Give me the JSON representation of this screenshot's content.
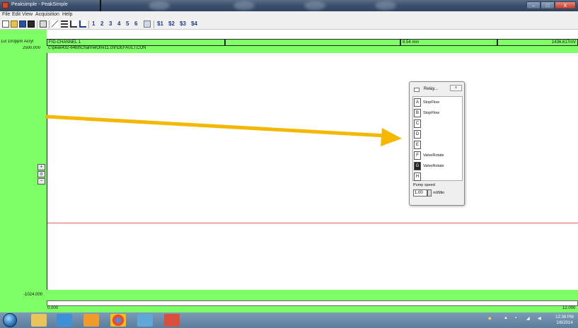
{
  "window": {
    "title": "Peaksimple - PeakSimple",
    "controls": {
      "minimize": "–",
      "maximize": "□",
      "close": "X"
    }
  },
  "menu": [
    "File",
    "Edit",
    "View",
    "Acquisition",
    "Help"
  ],
  "toolbar": {
    "channel_numbers": [
      "1",
      "2",
      "3",
      "4",
      "5",
      "6"
    ],
    "multi_buttons": [
      "$1",
      "$2",
      "$3",
      "$4"
    ]
  },
  "chromatogram": {
    "sample_label": "1ul 100ppm Acryl",
    "channel": "FID-CHANNEL 1",
    "time_readout": "8.54 min",
    "value_readout": "1436.617mV",
    "y_max": "2500.000",
    "file_path": "c:\\peak432-64bit\\ChannelOne11.chr\\DEFAULT.CON",
    "y_min": "-1024.000",
    "x_min": "0.000",
    "x_max": "12.000"
  },
  "relay_window": {
    "title": "Relay...",
    "close": "x",
    "relays": [
      {
        "key": "A",
        "label": "StopFlow",
        "active": false
      },
      {
        "key": "B",
        "label": "StopFlow",
        "active": false
      },
      {
        "key": "C",
        "label": "",
        "active": false
      },
      {
        "key": "D",
        "label": "",
        "active": false
      },
      {
        "key": "E",
        "label": "",
        "active": false
      },
      {
        "key": "F",
        "label": "ValveRotate",
        "active": false
      },
      {
        "key": "G",
        "label": "ValveRotate",
        "active": true
      },
      {
        "key": "H",
        "label": "",
        "active": false
      }
    ],
    "pump_label": "Pump speed",
    "pump_value": "1.00",
    "pump_unit": "ml/Min"
  },
  "taskbar": {
    "apps": [
      "explorer",
      "ie",
      "media-player",
      "chrome",
      "peaksimple",
      "app"
    ],
    "clock_time": "12:36 PM",
    "clock_date": "1/6/2014"
  },
  "colors": {
    "green_panel": "#7fff66",
    "arrow": "#f5b800",
    "baseline": "#e26060"
  }
}
